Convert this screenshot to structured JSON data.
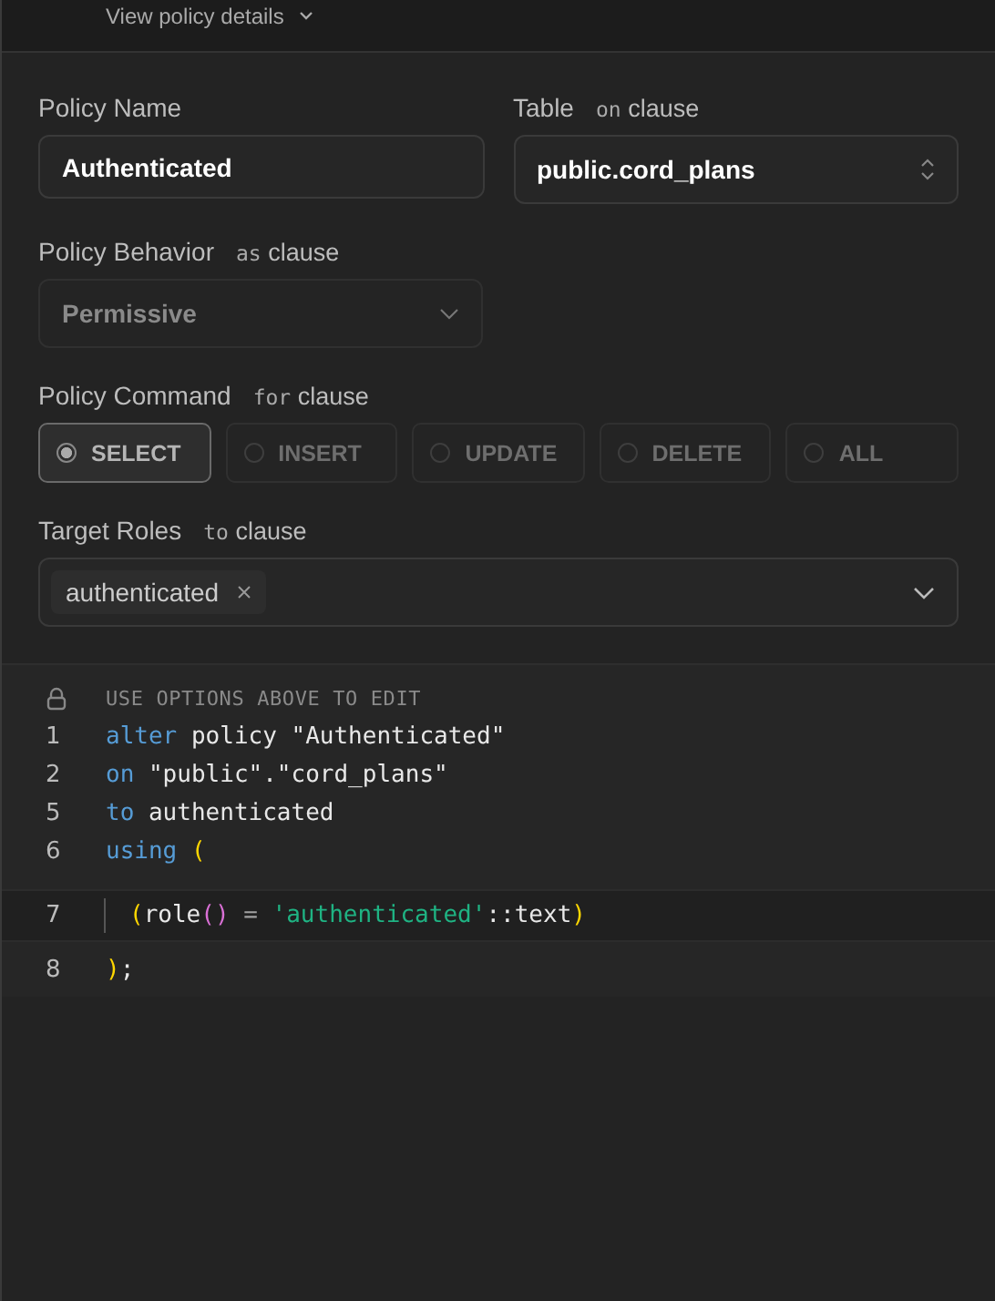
{
  "header": {
    "link": "View policy details"
  },
  "policy_name": {
    "label": "Policy Name",
    "value": "Authenticated"
  },
  "table": {
    "label": "Table",
    "clause_keyword": "on",
    "clause": "clause",
    "value": "public.cord_plans"
  },
  "behavior": {
    "label": "Policy Behavior",
    "clause_keyword": "as",
    "clause": "clause",
    "value": "Permissive",
    "disabled": true
  },
  "command": {
    "label": "Policy Command",
    "clause_keyword": "for",
    "clause": "clause",
    "options": [
      {
        "label": "SELECT",
        "selected": true
      },
      {
        "label": "INSERT",
        "selected": false
      },
      {
        "label": "UPDATE",
        "selected": false
      },
      {
        "label": "DELETE",
        "selected": false
      },
      {
        "label": "ALL",
        "selected": false
      }
    ]
  },
  "roles": {
    "label": "Target Roles",
    "clause_keyword": "to",
    "clause": "clause",
    "tags": [
      "authenticated"
    ]
  },
  "editor": {
    "notice": "USE OPTIONS ABOVE TO EDIT",
    "locked_lines": [
      {
        "number": "1",
        "tokens": [
          {
            "kind": "keyword",
            "text": "alter"
          },
          {
            "kind": "plain",
            "text": " policy \"Authenticated\""
          }
        ]
      },
      {
        "number": "2",
        "tokens": [
          {
            "kind": "keyword",
            "text": "on"
          },
          {
            "kind": "plain",
            "text": " \"public\".\"cord_plans\""
          }
        ]
      },
      {
        "number": "5",
        "tokens": [
          {
            "kind": "keyword",
            "text": "to"
          },
          {
            "kind": "plain",
            "text": " authenticated"
          }
        ]
      },
      {
        "number": "6",
        "tokens": [
          {
            "kind": "keyword",
            "text": "using"
          },
          {
            "kind": "paren",
            "text": " ("
          }
        ]
      }
    ],
    "edit_line": {
      "number": "7",
      "tokens": [
        {
          "kind": "paren",
          "text": "("
        },
        {
          "kind": "plain",
          "text": "role"
        },
        {
          "kind": "paren2",
          "text": "()"
        },
        {
          "kind": "operator",
          "text": " = "
        },
        {
          "kind": "string",
          "text": "'authenticated'"
        },
        {
          "kind": "plain",
          "text": "::text"
        },
        {
          "kind": "paren",
          "text": ")"
        }
      ]
    },
    "end_line": {
      "number": "8",
      "tokens": [
        {
          "kind": "paren",
          "text": ")"
        },
        {
          "kind": "plain",
          "text": ";"
        }
      ]
    }
  }
}
